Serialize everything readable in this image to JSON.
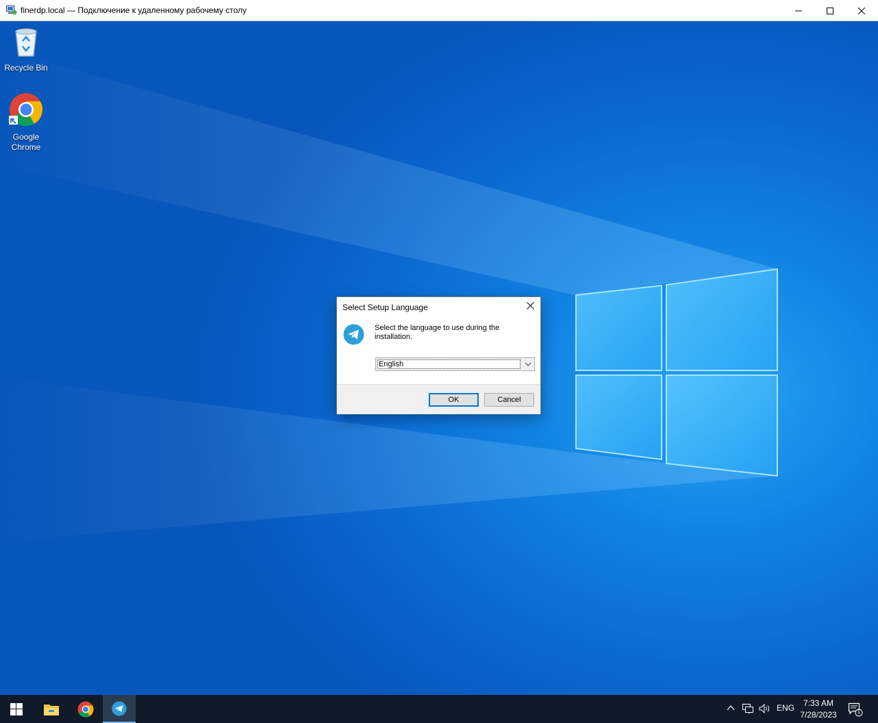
{
  "window": {
    "title": "finerdp.local — Подключение к удаленному рабочему столу",
    "minimize_icon": "minimize-icon",
    "maximize_icon": "maximize-icon",
    "close_icon": "close-icon"
  },
  "desktop": {
    "icons": [
      {
        "label": "Recycle Bin",
        "icon": "recycle-bin-icon"
      },
      {
        "label": "Google Chrome",
        "icon": "chrome-icon"
      }
    ]
  },
  "dialog": {
    "title": "Select Setup Language",
    "message": "Select the language to use during the installation.",
    "language_selected": "English",
    "ok_label": "OK",
    "cancel_label": "Cancel",
    "icon": "telegram-icon"
  },
  "taskbar": {
    "items": [
      "start-icon",
      "file-explorer-icon",
      "chrome-icon",
      "telegram-icon"
    ],
    "language": "ENG",
    "time": "7:33 AM",
    "date": "7/28/2023",
    "notification_count": "1"
  },
  "colors": {
    "desktop_blue": "#0a68d0",
    "taskbar": "#101a28",
    "accent": "#0078d7"
  }
}
